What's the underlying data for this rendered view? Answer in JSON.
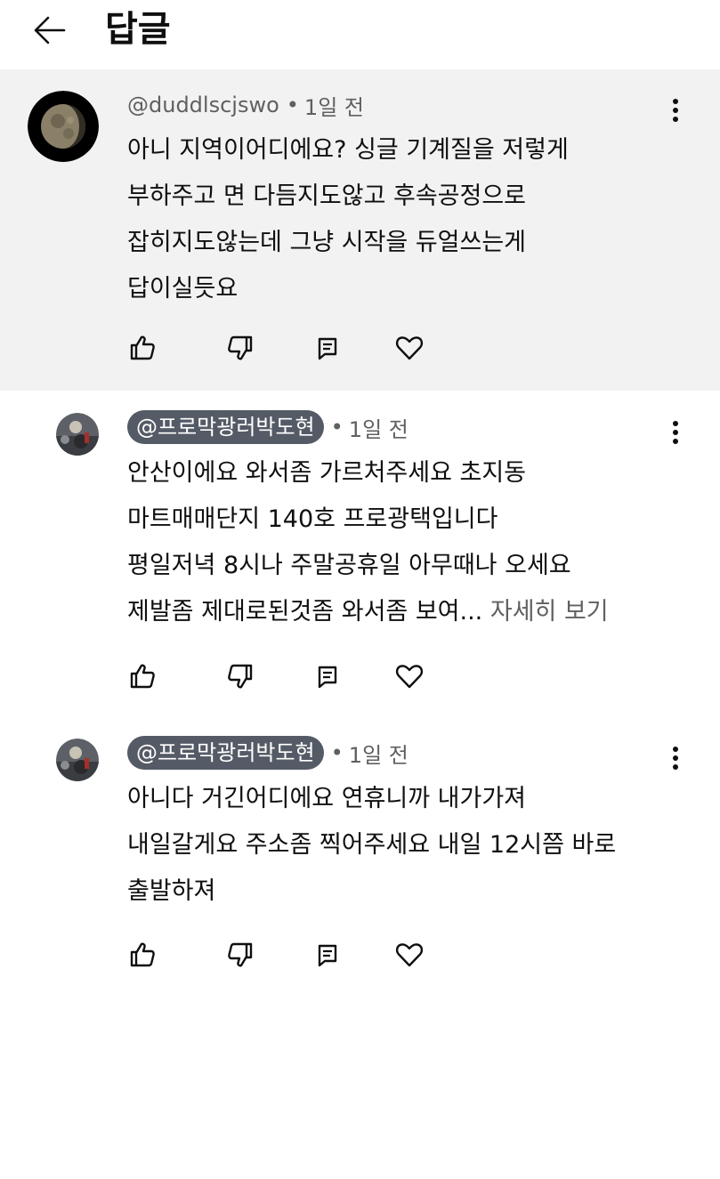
{
  "header": {
    "title": "답글",
    "back_icon": "arrow-left-icon"
  },
  "comments": [
    {
      "author": "@duddlscjswo",
      "time": "1일 전",
      "lines": [
        "아니 지역이어디에요? 싱글 기계질을 저렇게",
        "부하주고 면 다듬지도않고 후속공정으로",
        "잡히지도않는데 그냥 시작을 듀얼쓰는게",
        "답이실듯요"
      ],
      "highlighted": true
    },
    {
      "author": "@프로막광러박도현",
      "time": "1일 전",
      "lines": [
        "안산이에요 와서좀 가르처주세요 초지동",
        "마트매매단지 140호 프로광택입니다",
        "평일저녁 8시나 주말공휴일 아무때나 오세요",
        "제발좀 제대로된것좀 와서좀 보여..."
      ],
      "read_more": "자세히 보기"
    },
    {
      "author": "@프로막광러박도현",
      "time": "1일 전",
      "lines": [
        "아니다 거긴어디에요 연휴니까 내가가져",
        "내일갈게요 주소좀 찍어주세요 내일 12시쯤 바로",
        "출발하져"
      ]
    }
  ],
  "icons": {
    "like": "thumbs-up-icon",
    "dislike": "thumbs-down-icon",
    "reply": "reply-icon",
    "heart": "heart-icon",
    "more": "more-vertical-icon"
  },
  "separator": "•"
}
